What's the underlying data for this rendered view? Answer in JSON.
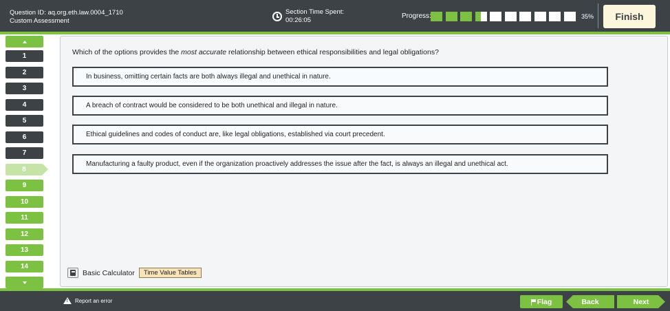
{
  "header": {
    "question_id": "Question ID: aq.org.eth.law.0004_1710",
    "assessment": "Custom Assessment",
    "time_label": "Section Time Spent:",
    "time_value": "00:26:05",
    "progress_label": "Progress:",
    "progress_percent_text": "35%",
    "progress_fraction": 0.35,
    "finish_label": "Finish"
  },
  "sidebar": {
    "up_icon": "chevron-up-icon",
    "down_icon": "chevron-down-icon",
    "items": [
      {
        "label": "1",
        "state": "answered"
      },
      {
        "label": "2",
        "state": "answered"
      },
      {
        "label": "3",
        "state": "answered"
      },
      {
        "label": "4",
        "state": "answered"
      },
      {
        "label": "5",
        "state": "answered"
      },
      {
        "label": "6",
        "state": "answered"
      },
      {
        "label": "7",
        "state": "answered"
      },
      {
        "label": "8",
        "state": "current"
      },
      {
        "label": "9",
        "state": "unanswered"
      },
      {
        "label": "10",
        "state": "unanswered"
      },
      {
        "label": "11",
        "state": "unanswered"
      },
      {
        "label": "12",
        "state": "unanswered"
      },
      {
        "label": "13",
        "state": "unanswered"
      },
      {
        "label": "14",
        "state": "unanswered"
      }
    ]
  },
  "question": {
    "prefix": "Which of the options provides the ",
    "emphasis": "most accurate",
    "suffix": " relationship between ethical responsibilities and legal obligations?",
    "options": [
      "In business, omitting certain facts are both always illegal and unethical in nature.",
      "A breach of contract would be considered to be both unethical and illegal in nature.",
      "Ethical guidelines and codes of conduct are, like legal obligations, established via court precedent.",
      "Manufacturing a faulty product, even if the organization proactively addresses the issue after the fact, is always an illegal and unethical act."
    ]
  },
  "tools": {
    "calculator_label": "Basic Calculator",
    "tvt_label": "Time Value Tables"
  },
  "footer": {
    "report_label": "Report an error",
    "flag_label": "Flag",
    "back_label": "Back",
    "next_label": "Next"
  },
  "colors": {
    "dark": "#3d4246",
    "green": "#7dc142",
    "current": "#c6e3a8",
    "finish_bg": "#fcf6dc"
  }
}
